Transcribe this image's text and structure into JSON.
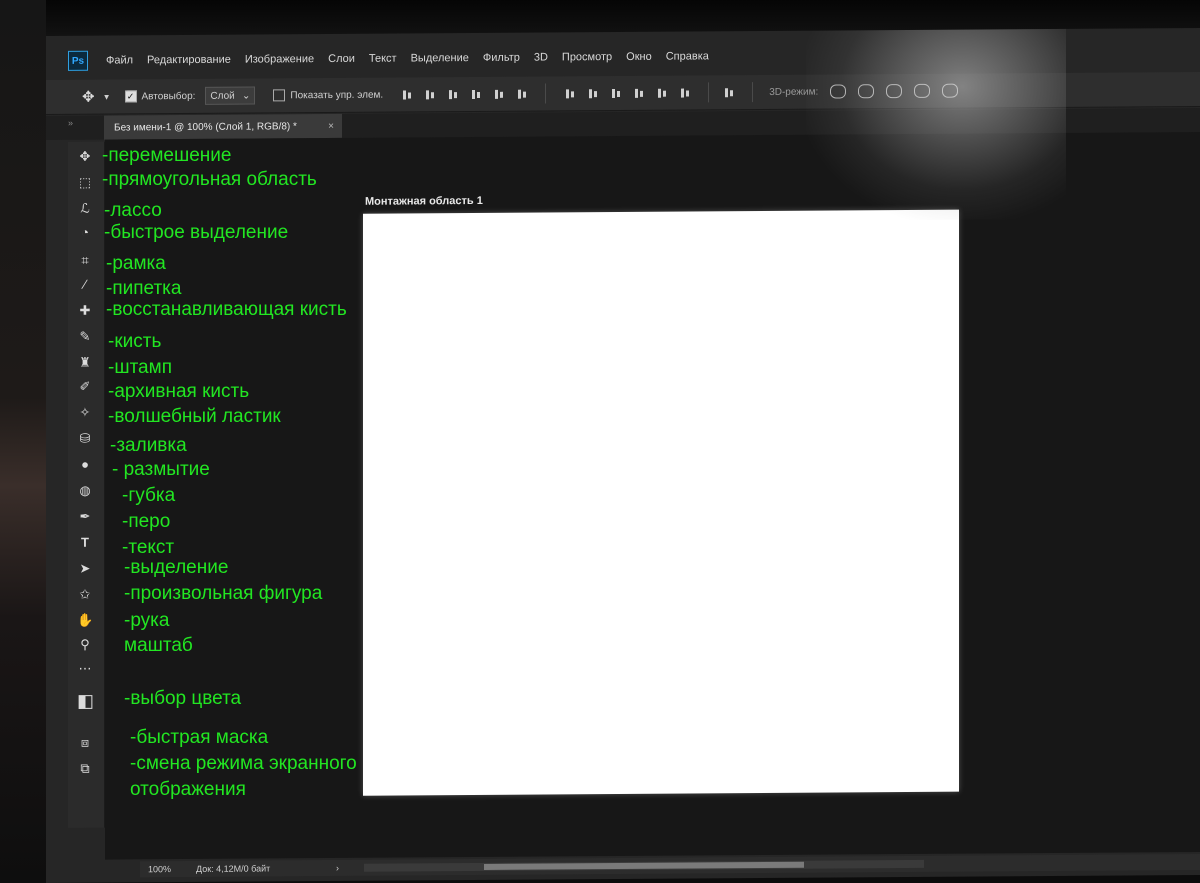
{
  "app": {
    "logo": "Ps"
  },
  "menu": [
    "Файл",
    "Редактирование",
    "Изображение",
    "Слои",
    "Текст",
    "Выделение",
    "Фильтр",
    "3D",
    "Просмотр",
    "Окно",
    "Справка"
  ],
  "options": {
    "autoselect_label": "Автовыбор:",
    "autoselect_value": "Слой",
    "show_controls_label": "Показать упр. элем.",
    "mode3d_label": "3D-режим:"
  },
  "tab": {
    "collapse": "»",
    "title": "Без имени-1 @ 100% (Слой 1, RGB/8) *",
    "close": "×"
  },
  "artboard": {
    "label": "Монтажная область 1"
  },
  "status": {
    "zoom": "100%",
    "doc_info": "Док: 4,12M/0 байт",
    "arrow": "›"
  },
  "tools": [
    {
      "icon": "move-icon",
      "glyph": "✥"
    },
    {
      "icon": "rect-marquee-icon",
      "glyph": "⬚"
    },
    {
      "icon": "lasso-icon",
      "glyph": "ℒ"
    },
    {
      "icon": "quick-selection-icon",
      "glyph": "◔"
    },
    {
      "icon": "crop-icon",
      "glyph": "⌗"
    },
    {
      "icon": "eyedropper-icon",
      "glyph": "⁄"
    },
    {
      "icon": "healing-brush-icon",
      "glyph": "✚"
    },
    {
      "icon": "brush-icon",
      "glyph": "✎"
    },
    {
      "icon": "stamp-icon",
      "glyph": "♜"
    },
    {
      "icon": "history-brush-icon",
      "glyph": "✐"
    },
    {
      "icon": "magic-eraser-icon",
      "glyph": "✧"
    },
    {
      "icon": "paint-bucket-icon",
      "glyph": "⛁"
    },
    {
      "icon": "blur-icon",
      "glyph": "●"
    },
    {
      "icon": "sponge-icon",
      "glyph": "◍"
    },
    {
      "icon": "pen-icon",
      "glyph": "✒"
    },
    {
      "icon": "type-icon",
      "glyph": "T"
    },
    {
      "icon": "path-selection-icon",
      "glyph": "➤"
    },
    {
      "icon": "custom-shape-icon",
      "glyph": "✩"
    },
    {
      "icon": "hand-icon",
      "glyph": "✋"
    },
    {
      "icon": "zoom-icon",
      "glyph": "⚲"
    },
    {
      "icon": "more-icon",
      "glyph": "⋯"
    },
    {
      "icon": "color-swatch-icon",
      "glyph": "◧"
    },
    {
      "icon": "quick-mask-icon",
      "glyph": "⧈"
    },
    {
      "icon": "screen-mode-icon",
      "glyph": "⧉"
    }
  ],
  "annotations": [
    "-перемешение",
    "-прямоугольная область",
    "-лассо",
    "-быстрое выделение",
    "-рамка",
    "-пипетка",
    "-восстанавливающая кисть",
    "-кисть",
    "-штамп",
    "-архивная кисть",
    "-волшебный ластик",
    "-заливка",
    "- размытие",
    "-губка",
    "-перо",
    "-текст",
    "-выделение",
    "-произвольная фигура",
    "-рука",
    "маштаб",
    "-выбор цвета",
    "-быстрая маска",
    "-смена режима экранного",
    "отображения"
  ]
}
